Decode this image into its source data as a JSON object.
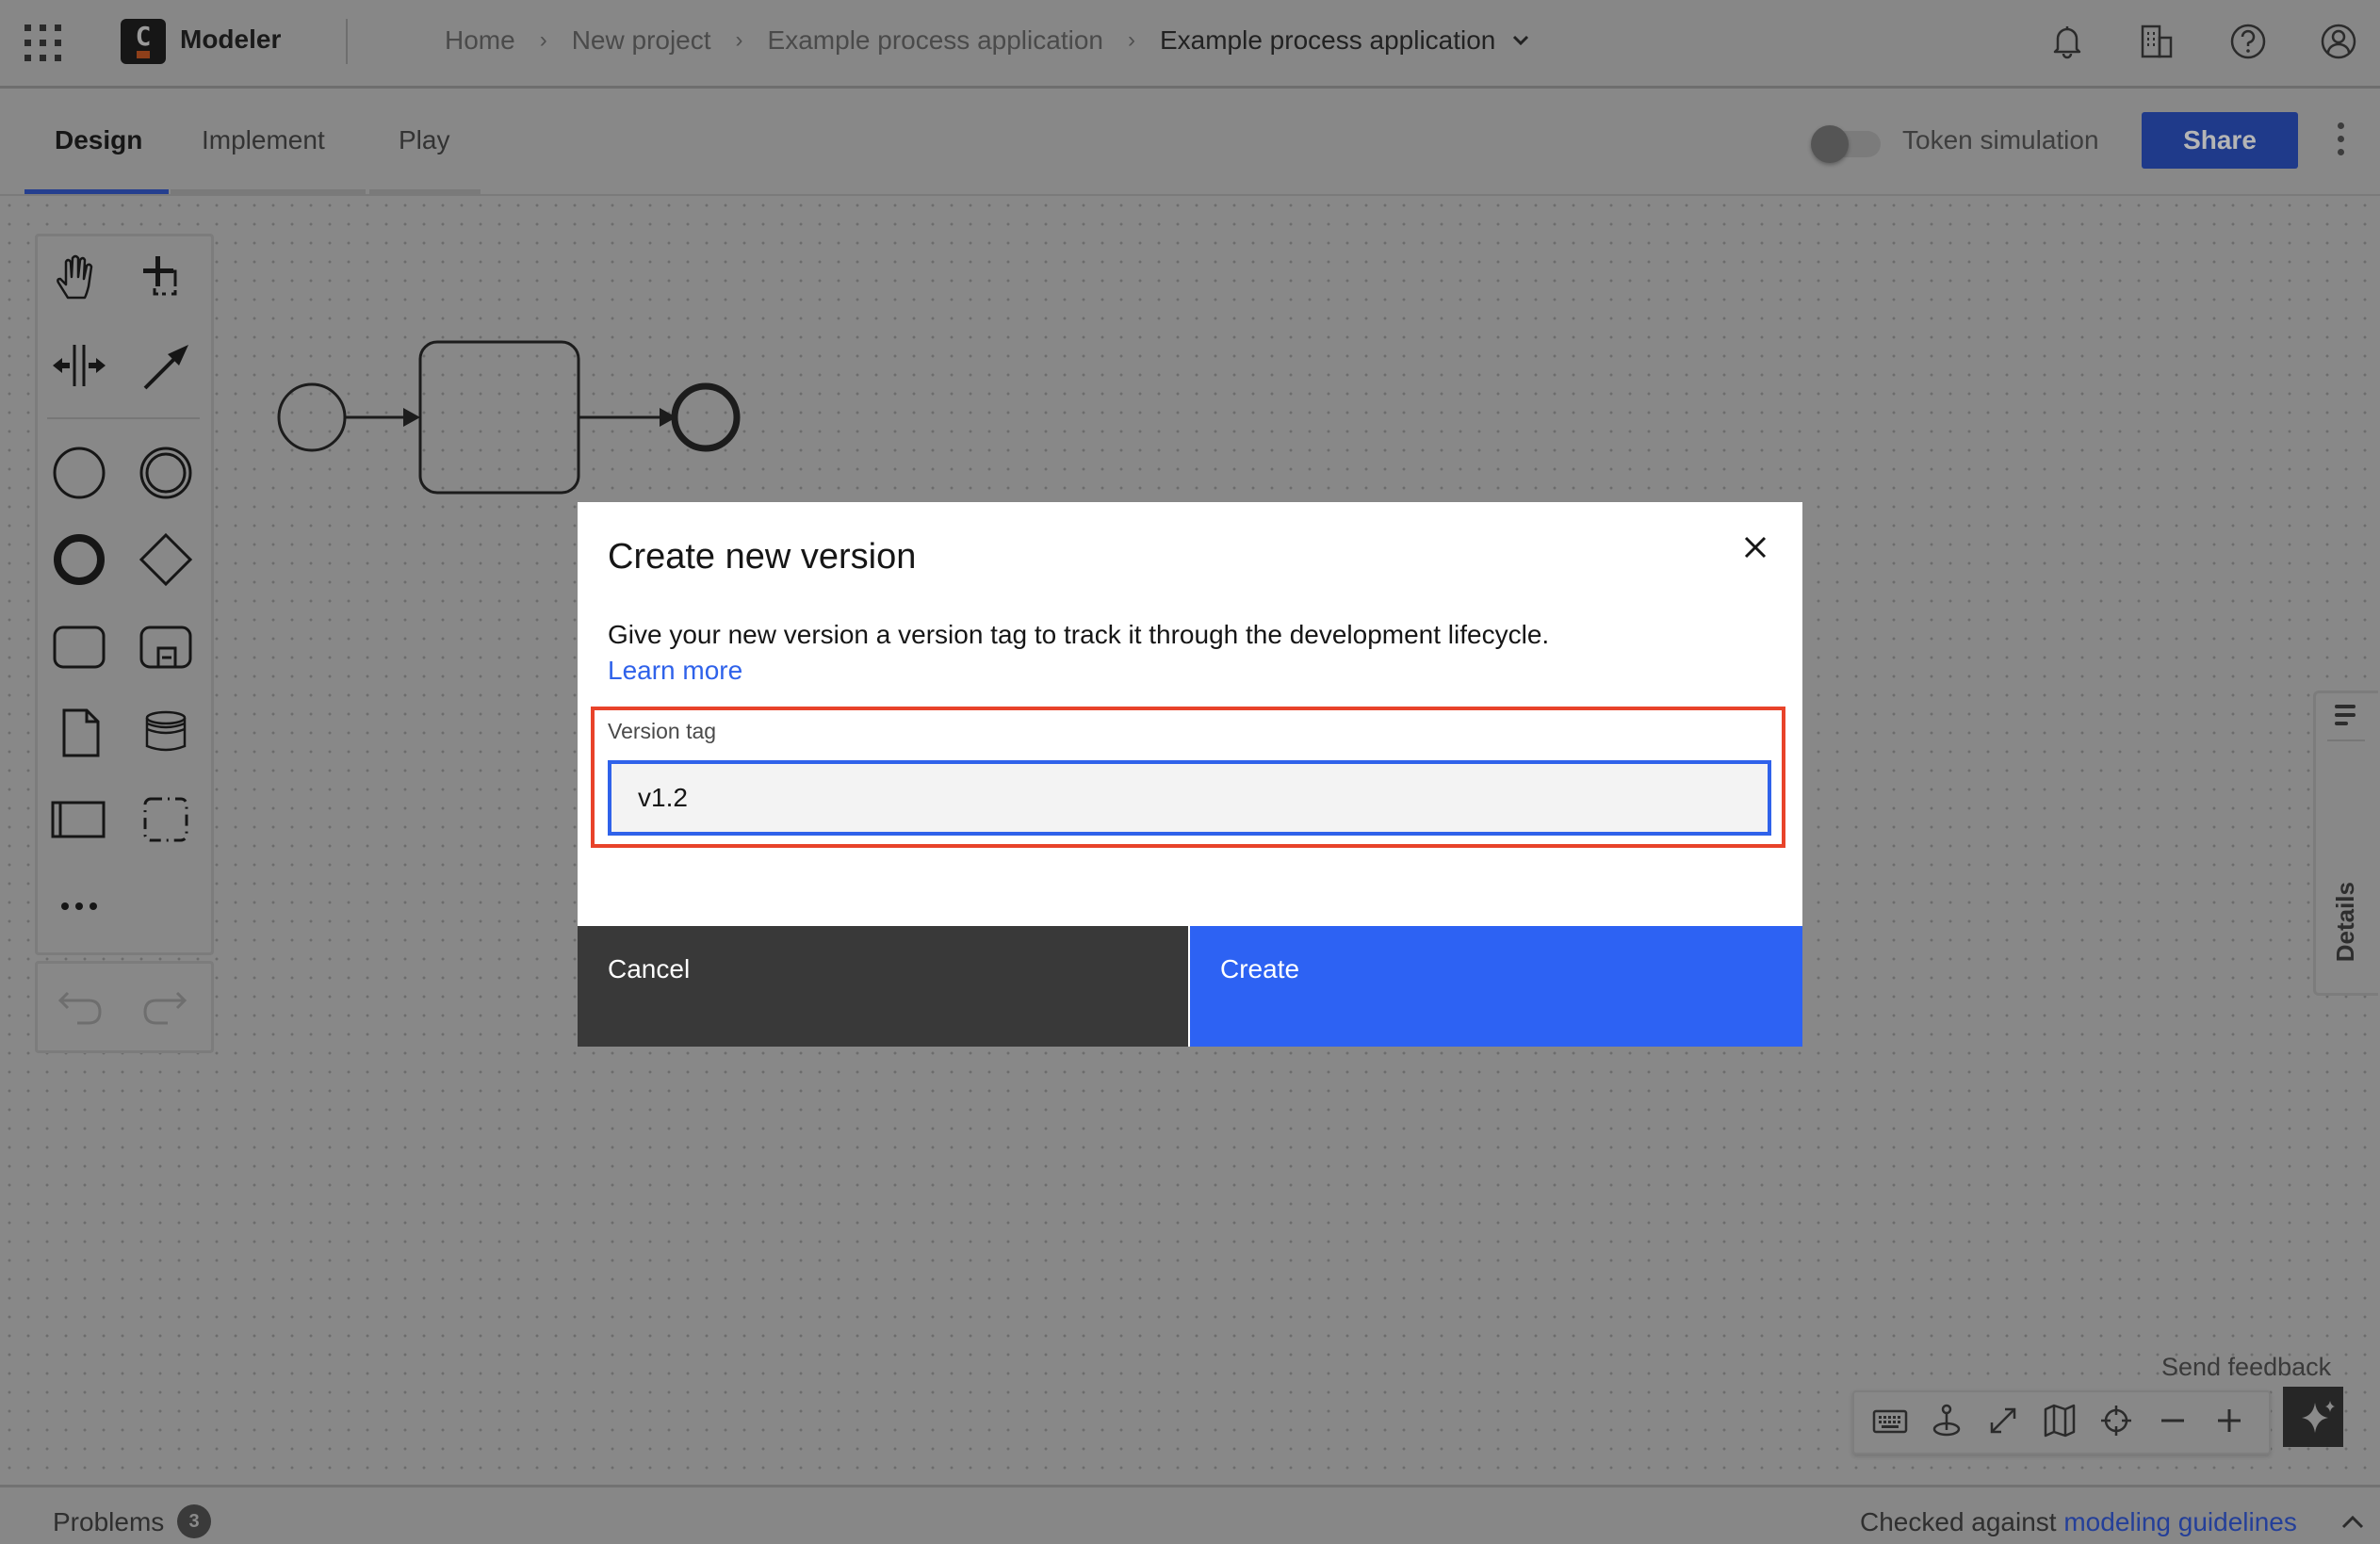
{
  "header": {
    "app_name": "Modeler",
    "logo_letter": "C",
    "breadcrumb": [
      "Home",
      "New project",
      "Example process application"
    ],
    "breadcrumb_current": "Example process application",
    "breadcrumb_separator": "›",
    "icons": [
      "notification-bell-icon",
      "organization-building-icon",
      "help-icon",
      "user-profile-icon"
    ]
  },
  "tabs": [
    {
      "label": "Design",
      "active": true
    },
    {
      "label": "Implement",
      "active": false
    },
    {
      "label": "Play",
      "active": false
    }
  ],
  "toolbar": {
    "token_simulation_label": "Token simulation",
    "token_simulation_on": false,
    "share_label": "Share"
  },
  "palette": {
    "tools": [
      "hand-tool",
      "lasso-tool",
      "space-tool",
      "global-connect-tool"
    ],
    "elements": [
      "start-event",
      "intermediate-event",
      "end-event",
      "gateway",
      "task",
      "subprocess",
      "data-object",
      "data-store",
      "pool",
      "group",
      "more"
    ],
    "history": [
      "undo",
      "redo"
    ]
  },
  "diagram": {
    "elements": [
      "start-event",
      "sequence-flow",
      "task",
      "sequence-flow",
      "end-event"
    ]
  },
  "dialog": {
    "title": "Create new version",
    "description": "Give your new version a version tag to track it through the development lifecycle.",
    "learn_more": "Learn more",
    "field_label": "Version tag",
    "field_value": "v1.2",
    "cancel_label": "Cancel",
    "create_label": "Create"
  },
  "details_panel": {
    "label": "Details"
  },
  "canvas_controls": {
    "send_feedback": "Send feedback",
    "buttons": [
      "keyboard-shortcuts",
      "reset-view",
      "fullscreen",
      "minimap",
      "center",
      "zoom-out",
      "zoom-in"
    ],
    "ai_button": "ai-assistant"
  },
  "footer": {
    "problems_label": "Problems",
    "problems_count": "3",
    "checked_prefix": "Checked against",
    "checked_link": "modeling guidelines"
  },
  "colors": {
    "primary_blue": "#2d62f3",
    "highlight_red": "#e8432a",
    "overlay_gray": "#888888"
  }
}
